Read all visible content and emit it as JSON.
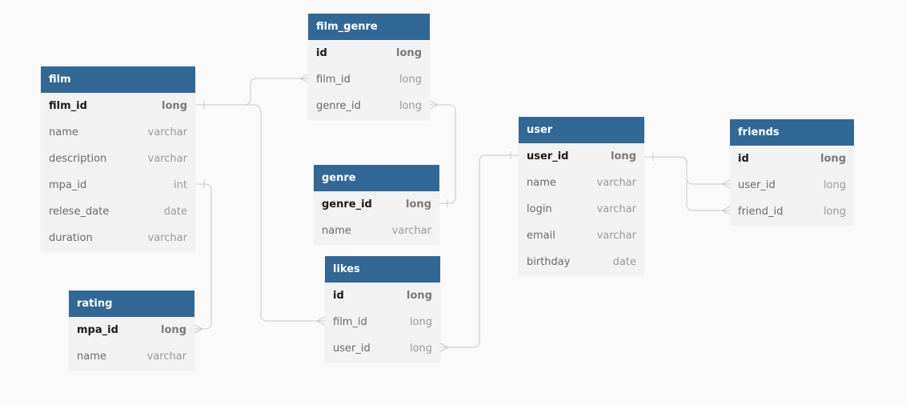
{
  "colors": {
    "header_bg": "#326896",
    "header_text": "#ffffff",
    "table_bg": "#f2f2f2",
    "canvas_bg": "#fafafa",
    "connector": "#c8c8c8"
  },
  "tables": {
    "film": {
      "title": "film",
      "columns": [
        {
          "name": "film_id",
          "type": "long",
          "pk": true
        },
        {
          "name": "name",
          "type": "varchar"
        },
        {
          "name": "description",
          "type": "varchar"
        },
        {
          "name": "mpa_id",
          "type": "int"
        },
        {
          "name": "relese_date",
          "type": "date"
        },
        {
          "name": "duration",
          "type": "varchar"
        }
      ]
    },
    "film_genre": {
      "title": "film_genre",
      "columns": [
        {
          "name": "id",
          "type": "long",
          "pk": true
        },
        {
          "name": "film_id",
          "type": "long"
        },
        {
          "name": "genre_id",
          "type": "long"
        }
      ]
    },
    "genre": {
      "title": "genre",
      "columns": [
        {
          "name": "genre_id",
          "type": "long",
          "pk": true
        },
        {
          "name": "name",
          "type": "varchar"
        }
      ]
    },
    "likes": {
      "title": "likes",
      "columns": [
        {
          "name": "id",
          "type": "long",
          "pk": true
        },
        {
          "name": "film_id",
          "type": "long"
        },
        {
          "name": "user_id",
          "type": "long"
        }
      ]
    },
    "rating": {
      "title": "rating",
      "columns": [
        {
          "name": "mpa_id",
          "type": "long",
          "pk": true
        },
        {
          "name": "name",
          "type": "varchar"
        }
      ]
    },
    "user": {
      "title": "user",
      "columns": [
        {
          "name": "user_id",
          "type": "long",
          "pk": true
        },
        {
          "name": "name",
          "type": "varchar"
        },
        {
          "name": "login",
          "type": "varchar"
        },
        {
          "name": "email",
          "type": "varchar"
        },
        {
          "name": "birthday",
          "type": "date"
        }
      ]
    },
    "friends": {
      "title": "friends",
      "columns": [
        {
          "name": "id",
          "type": "long",
          "pk": true
        },
        {
          "name": "user_id",
          "type": "long"
        },
        {
          "name": "friend_id",
          "type": "long"
        }
      ]
    }
  },
  "relations": [
    {
      "from": "film.film_id",
      "to": "film_genre.film_id",
      "type": "one-to-many"
    },
    {
      "from": "film.film_id",
      "to": "likes.film_id",
      "type": "one-to-many"
    },
    {
      "from": "genre.genre_id",
      "to": "film_genre.genre_id",
      "type": "one-to-many"
    },
    {
      "from": "rating.mpa_id",
      "to": "film.mpa_id",
      "type": "one-to-many"
    },
    {
      "from": "user.user_id",
      "to": "likes.user_id",
      "type": "one-to-many"
    },
    {
      "from": "user.user_id",
      "to": "friends.user_id",
      "type": "one-to-many"
    },
    {
      "from": "user.user_id",
      "to": "friends.friend_id",
      "type": "one-to-many"
    }
  ]
}
